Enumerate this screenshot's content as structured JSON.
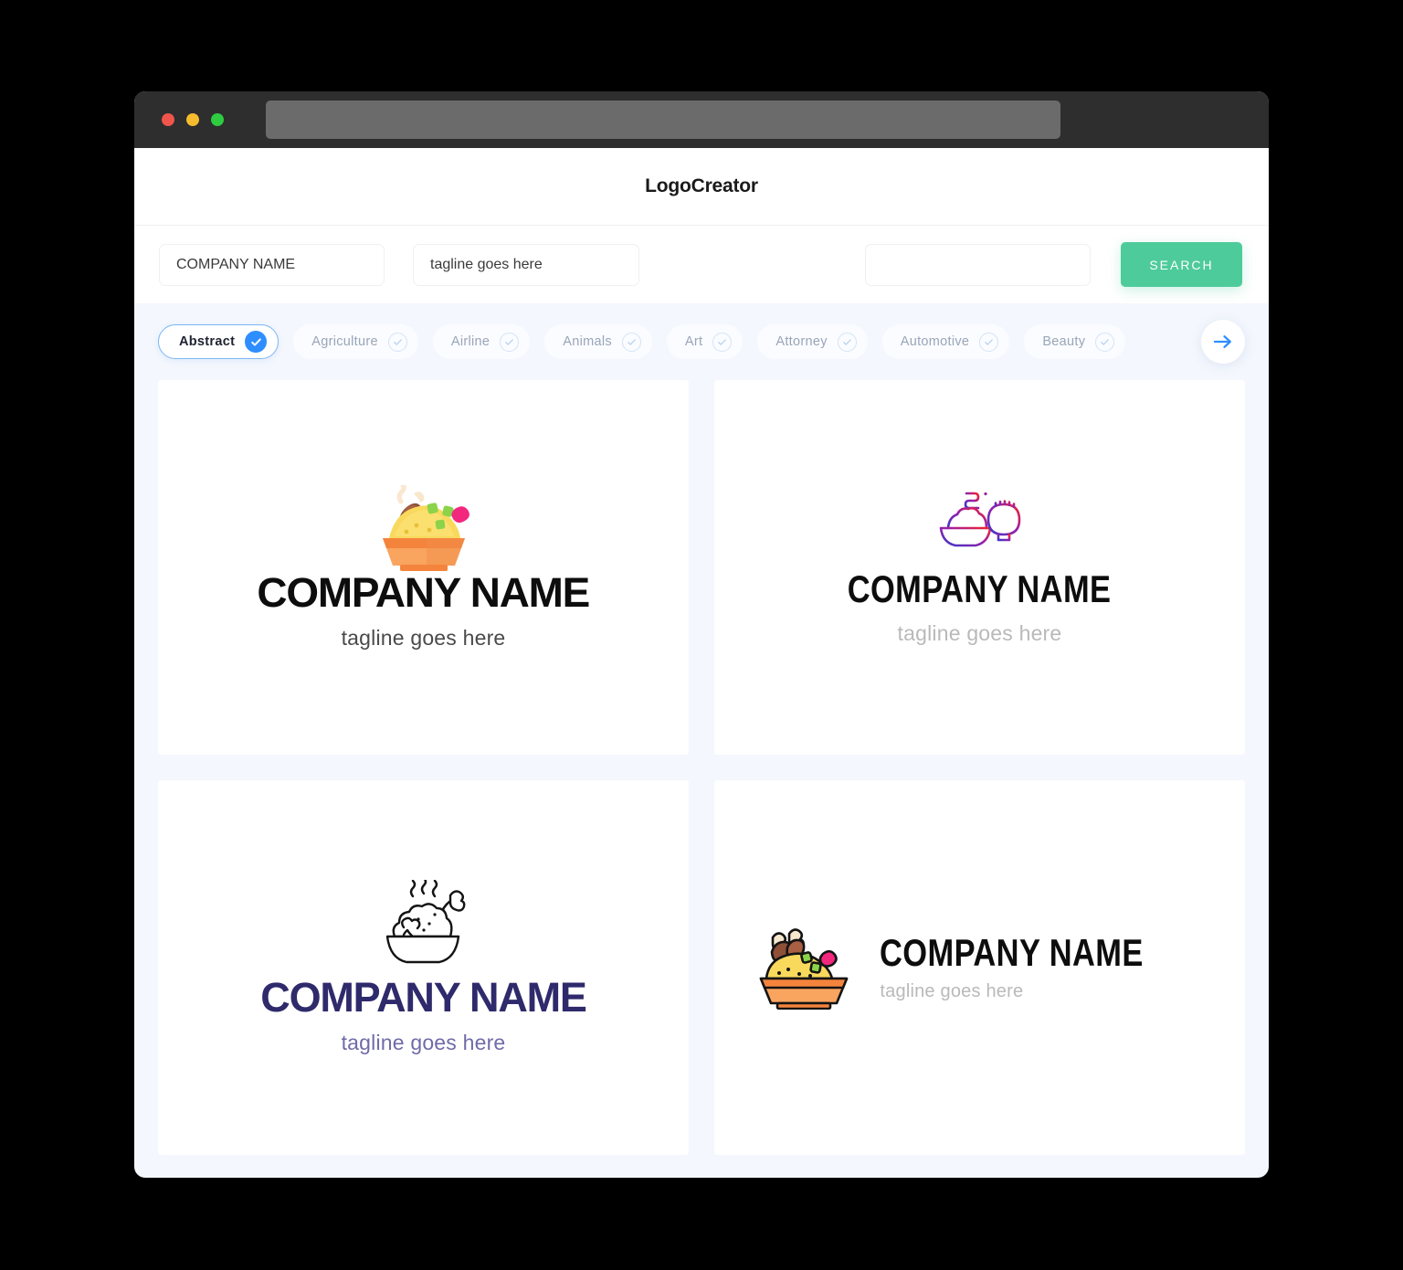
{
  "window": {
    "traffic_lights": [
      "close",
      "minimize",
      "maximize"
    ],
    "url_value": ""
  },
  "header": {
    "title": "LogoCreator"
  },
  "search": {
    "company_value": "COMPANY NAME",
    "tagline_value": "tagline goes here",
    "extra_value": "",
    "search_label": "SEARCH",
    "accent_color": "#4ecb9a"
  },
  "categories": {
    "active_color": "#2f8eff",
    "items": [
      {
        "label": "Abstract",
        "selected": true
      },
      {
        "label": "Agriculture",
        "selected": false
      },
      {
        "label": "Airline",
        "selected": false
      },
      {
        "label": "Animals",
        "selected": false
      },
      {
        "label": "Art",
        "selected": false
      },
      {
        "label": "Attorney",
        "selected": false
      },
      {
        "label": "Automotive",
        "selected": false
      },
      {
        "label": "Beauty",
        "selected": false
      }
    ],
    "next_label": "next-categories"
  },
  "results": {
    "cards": [
      {
        "name": "COMPANY NAME",
        "tagline": "tagline goes here",
        "layout": "vertical",
        "icon": "filled-rice-bowl-icon",
        "name_color": "#0d0d0d",
        "tagline_color": "#4a4a4a"
      },
      {
        "name": "COMPANY NAME",
        "tagline": "tagline goes here",
        "layout": "vertical",
        "icon": "gradient-rice-bowls-icon",
        "name_color": "#0d0d0d",
        "tagline_color": "#b9b9b9"
      },
      {
        "name": "COMPANY NAME",
        "tagline": "tagline goes here",
        "layout": "vertical",
        "icon": "outline-chicken-bowl-icon",
        "name_color": "#2e2a6b",
        "tagline_color": "#6f6ba8"
      },
      {
        "name": "COMPANY NAME",
        "tagline": "tagline goes here",
        "layout": "horizontal",
        "icon": "outlined-rice-bowl-icon",
        "name_color": "#0d0d0d",
        "tagline_color": "#b9b9b9"
      }
    ]
  }
}
